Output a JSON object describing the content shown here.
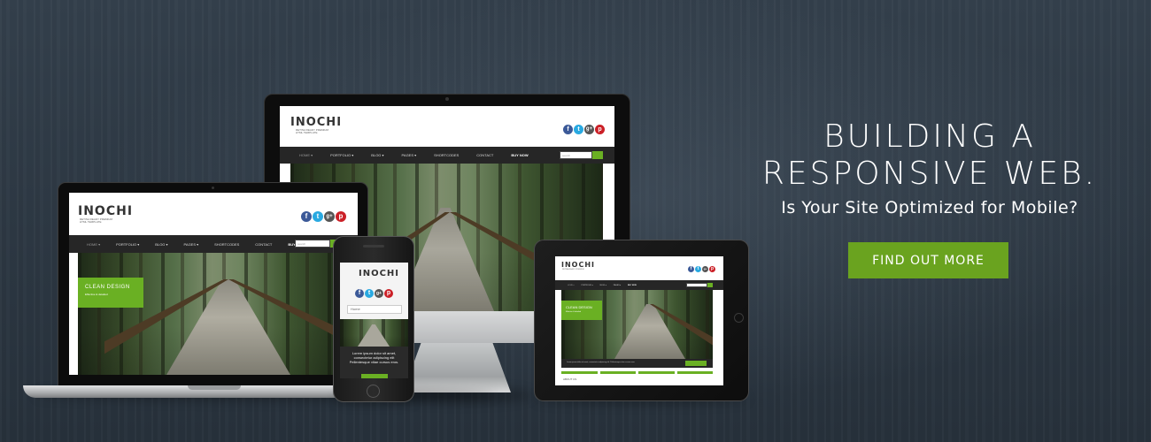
{
  "hero": {
    "headline_line1": "BUILDING A",
    "headline_line2": "RESPONSIVE WEB.",
    "subheadline": "Is Your Site Optimized for Mobile?",
    "cta_label": "FIND OUT MORE"
  },
  "site_template": {
    "logo": "INOCHI",
    "tagline_line1": "RETINA READY PREMIUM",
    "tagline_line2": "HTML TEMPLATE",
    "nav_items": [
      "HOME ▾",
      "PORTFOLIO ▾",
      "BLOG ▾",
      "PAGES ▾",
      "SHORTCODES",
      "CONTACT",
      "BUY NOW"
    ],
    "search_placeholder": "search",
    "slide_title": "CLEAN DESIGN",
    "slide_subtitle": "Effective & detailed",
    "mobile_search_placeholder": "Home",
    "mobile_caption": "Lorem ipsum dolor sit amet, consectetur adipiscing elit Pellentesque vitae cursus eros.",
    "tablet_caption": "Lorem ipsum dolor sit amet, consectetur adipiscing elit. Pellentesque vitae cursus eros.",
    "tablet_footer": "ABOUT US"
  },
  "colors": {
    "accent_green": "#6aa31f",
    "background": "#2f3a45",
    "facebook": "#3b5998",
    "twitter": "#29a9e1",
    "googleplus": "#555555",
    "pinterest": "#cb2027"
  },
  "icons": [
    "facebook-icon",
    "twitter-icon",
    "googleplus-icon",
    "pinterest-icon",
    "search-icon"
  ]
}
